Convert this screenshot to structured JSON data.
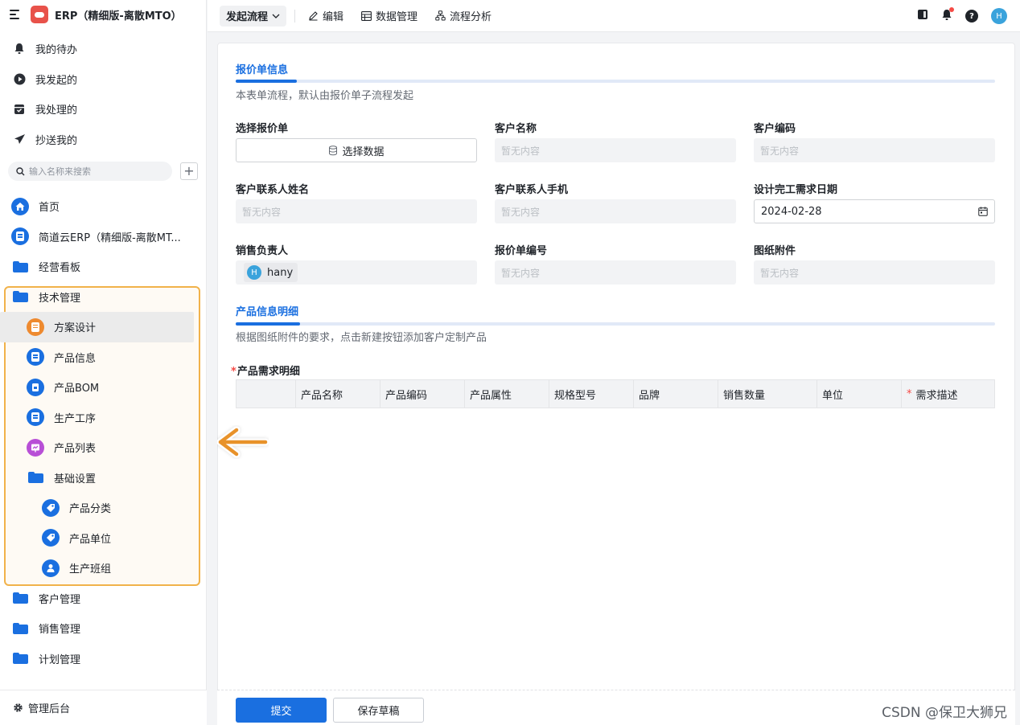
{
  "app": {
    "title": "ERP（精细版-离散MTO）",
    "logo_color": "#e8524a"
  },
  "quick_nav": [
    {
      "icon": "bell-icon",
      "label": "我的待办"
    },
    {
      "icon": "play-circle-icon",
      "label": "我发起的"
    },
    {
      "icon": "inbox-check-icon",
      "label": "我处理的"
    },
    {
      "icon": "send-icon",
      "label": "抄送我的"
    }
  ],
  "search": {
    "placeholder": "输入名称来搜索",
    "add_label": "+"
  },
  "nav": [
    {
      "icon": "home-icon",
      "label": "首页"
    },
    {
      "icon": "form-icon",
      "label": "简道云ERP（精细版-离散MT..."
    },
    {
      "icon": "folder-icon",
      "label": "经营看板"
    },
    {
      "icon": "folder-open-icon",
      "label": "技术管理"
    },
    {
      "icon": "form-icon",
      "label": "方案设计",
      "active": true
    },
    {
      "icon": "form-icon",
      "label": "产品信息"
    },
    {
      "icon": "bom-icon",
      "label": "产品BOM"
    },
    {
      "icon": "form-icon",
      "label": "生产工序"
    },
    {
      "icon": "report-icon",
      "label": "产品列表"
    },
    {
      "icon": "folder-open-icon",
      "label": "基础设置"
    },
    {
      "icon": "tag-icon",
      "label": "产品分类"
    },
    {
      "icon": "tag-icon",
      "label": "产品单位"
    },
    {
      "icon": "team-icon",
      "label": "生产班组"
    },
    {
      "icon": "folder-icon",
      "label": "客户管理"
    },
    {
      "icon": "folder-icon",
      "label": "销售管理"
    },
    {
      "icon": "folder-icon",
      "label": "计划管理"
    }
  ],
  "footer": {
    "label": "管理后台"
  },
  "toolbar": {
    "flow_label": "发起流程",
    "edit_label": "编辑",
    "data_label": "数据管理",
    "analysis_label": "流程分析",
    "avatar": "H"
  },
  "form": {
    "section1": {
      "title": "报价单信息",
      "desc": "本表单流程，默认由报价单子流程发起"
    },
    "fields": {
      "select_quote": {
        "label": "选择报价单",
        "button": "选择数据"
      },
      "customer_name": {
        "label": "客户名称",
        "value": "暂无内容"
      },
      "customer_code": {
        "label": "客户编码",
        "value": "暂无内容"
      },
      "contact_name": {
        "label": "客户联系人姓名",
        "value": "暂无内容"
      },
      "contact_phone": {
        "label": "客户联系人手机",
        "value": "暂无内容"
      },
      "design_date": {
        "label": "设计完工需求日期",
        "value": "2024-02-28"
      },
      "sales_owner": {
        "label": "销售负责人",
        "avatar": "H",
        "name": "hany"
      },
      "quote_no": {
        "label": "报价单编号",
        "value": "暂无内容"
      },
      "drawing": {
        "label": "图纸附件",
        "value": "暂无内容"
      }
    },
    "section2": {
      "title": "产品信息明细",
      "desc": "根据图纸附件的要求，点击新建按钮添加客户定制产品"
    },
    "table": {
      "title": "产品需求明细",
      "required_mark": "*",
      "columns": [
        "",
        "产品名称",
        "产品编码",
        "产品属性",
        "规格型号",
        "品牌",
        "销售数量",
        "单位",
        "需求描述"
      ]
    }
  },
  "actions": {
    "submit": "提交",
    "save_draft": "保存草稿"
  },
  "watermark": "CSDN @保卫大狮兄",
  "colors": {
    "primary": "#1a6fe0",
    "highlight_border": "#f1b24a",
    "arrow": "#e8922a"
  }
}
